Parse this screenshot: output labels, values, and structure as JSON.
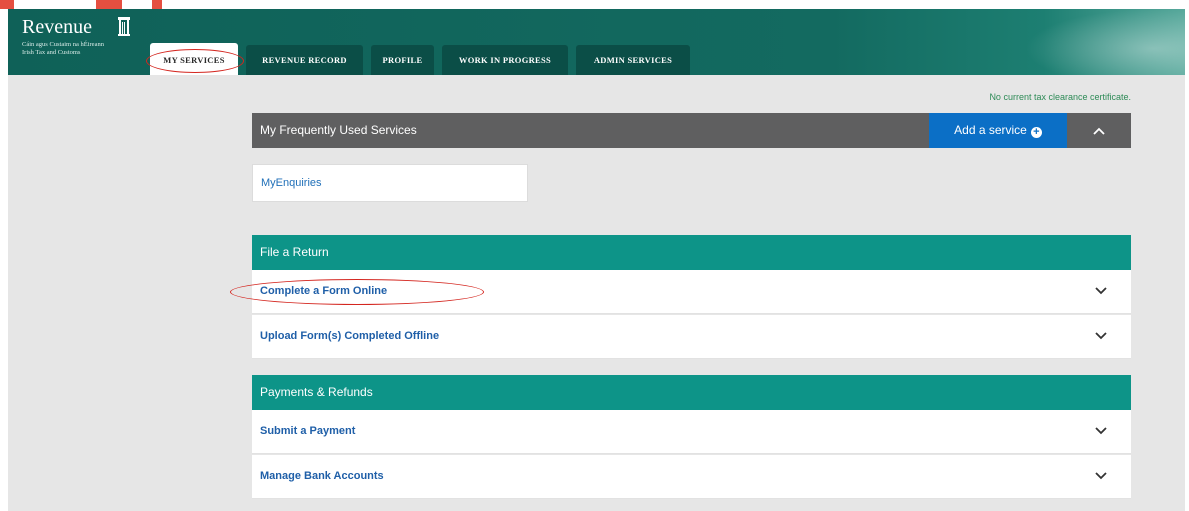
{
  "brand": {
    "name": "Revenue",
    "subtitle_line1": "Cáin agus Custaim na hÉireann",
    "subtitle_line2": "Irish Tax and Customs"
  },
  "nav": {
    "tabs": [
      {
        "label": "MY SERVICES",
        "active": true
      },
      {
        "label": "REVENUE RECORD",
        "active": false
      },
      {
        "label": "PROFILE",
        "active": false
      },
      {
        "label": "WORK IN PROGRESS",
        "active": false
      },
      {
        "label": "ADMIN SERVICES",
        "active": false
      }
    ]
  },
  "tax_clearance_note": "No current tax clearance certificate.",
  "frequent": {
    "title": "My Frequently Used Services",
    "add_label": "Add a service",
    "items": [
      "MyEnquiries"
    ]
  },
  "file_return": {
    "title": "File a Return",
    "rows": [
      "Complete a Form Online",
      "Upload Form(s) Completed Offline"
    ]
  },
  "payments": {
    "title": "Payments & Refunds",
    "rows": [
      "Submit a Payment",
      "Manage Bank Accounts"
    ]
  },
  "colors": {
    "header_teal": "#136a60",
    "section_teal": "#0d9488",
    "grey_header": "#5f5f60",
    "add_button_blue": "#0b6fc6",
    "link_blue": "#1f5fa8",
    "annotation_red": "#d4261f"
  },
  "icons": {
    "plus": "plus-circle-icon",
    "collapse": "chevron-up-icon",
    "expand": "chevron-down-icon",
    "logo": "harp-icon"
  }
}
